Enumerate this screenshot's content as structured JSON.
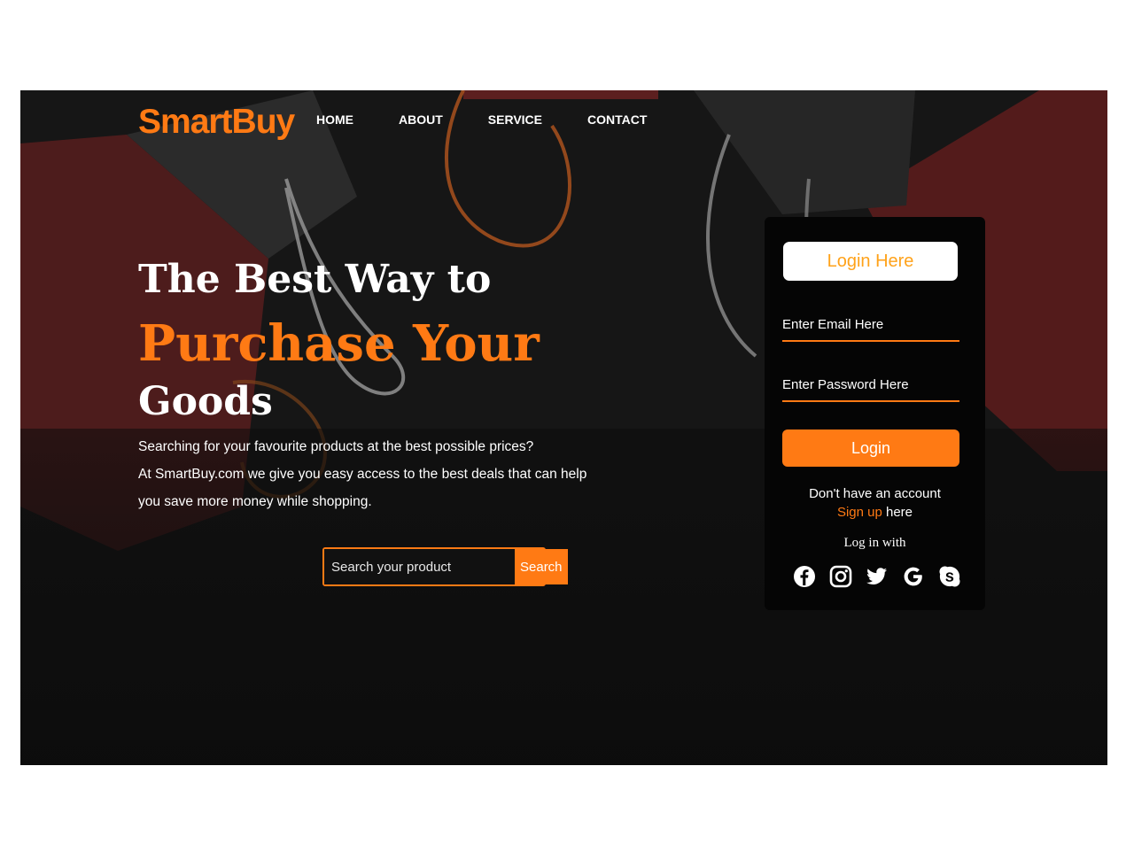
{
  "brand": {
    "name": "SmartBuy",
    "accent": "#ff7a14"
  },
  "nav": {
    "items": [
      "HOME",
      "ABOUT",
      "SERVICE",
      "CONTACT"
    ]
  },
  "hero": {
    "line1": "The Best Way to",
    "line2": "Purchase Your",
    "line3": "Goods",
    "description": [
      "Searching for your favourite products at the best possible prices?",
      "At SmartBuy.com we give you easy access to the best deals that can help",
      "you save more money while shopping."
    ]
  },
  "search": {
    "placeholder": "Search your product",
    "button_label": "Search"
  },
  "login": {
    "title": "Login Here",
    "email_placeholder": "Enter Email Here",
    "password_placeholder": "Enter Password Here",
    "button_label": "Login",
    "no_account_text": "Don't have an account",
    "signup_link": "Sign up",
    "signup_suffix": " here",
    "login_with": "Log in with",
    "socials": [
      "facebook-icon",
      "instagram-icon",
      "twitter-icon",
      "google-icon",
      "skype-icon"
    ]
  }
}
